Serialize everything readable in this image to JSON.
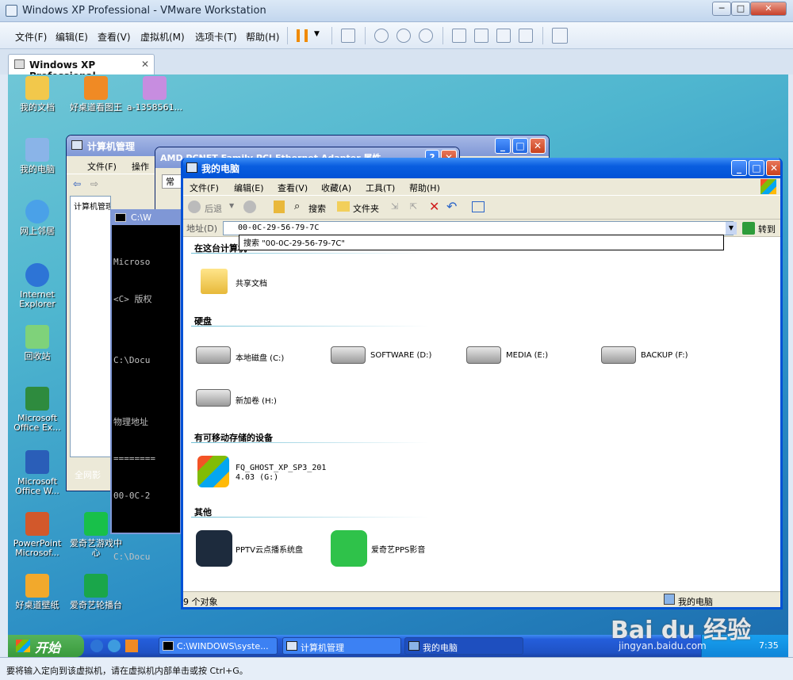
{
  "host": {
    "title": "Windows XP Professional - VMware Workstation",
    "menu": [
      "文件(F)",
      "编辑(E)",
      "查看(V)",
      "虚拟机(M)",
      "选项卡(T)",
      "帮助(H)"
    ],
    "tab": "Windows XP Professional",
    "status": "要将输入定向到该虚拟机，请在虚拟机内部单击或按 Ctrl+G。"
  },
  "desktop": {
    "icons": [
      {
        "label": "我的文档",
        "color": "#f2c84b"
      },
      {
        "label": "好桌道看图王",
        "color": "#f08a24"
      },
      {
        "label": "a-1358561...",
        "color": "#c78de0"
      },
      {
        "label": "我的电脑",
        "color": "#8ab4e8"
      },
      {
        "label": "网上邻居",
        "color": "#4aa1e8"
      },
      {
        "label": "Internet Explorer",
        "color": "#2d74d6"
      },
      {
        "label": "回收站",
        "color": "#7fd27a"
      },
      {
        "label": "Microsoft Office Ex...",
        "color": "#2e8b3e"
      },
      {
        "label": "Microsoft Office W...",
        "color": "#2a5eb8"
      },
      {
        "label": "PowerPoint Microsof...",
        "color": "#d2582b"
      },
      {
        "label": "爱奇艺游戏中心",
        "color": "#18c04a"
      },
      {
        "label": "好桌道壁纸",
        "color": "#f2a92c"
      },
      {
        "label": "爱奇艺轮播台",
        "color": "#1aa64a"
      },
      {
        "label": "全网影"
      }
    ]
  },
  "comp_mgmt": {
    "title": "计算机管理",
    "menu": [
      "文件(F)",
      "操作"
    ],
    "tree_root": "计算机管理(本地"
  },
  "nic_props": {
    "title": "AMD PCNET Family PCI Ethernet Adapter 属性",
    "tab": "常"
  },
  "cmd": {
    "title": "C:\\W",
    "lines": [
      "Microso",
      "<C> 版权",
      "",
      "C:\\Docu",
      "",
      "物理地址",
      "========",
      "00-0C-2",
      "",
      "C:\\Docu"
    ]
  },
  "my_computer": {
    "title": "我的电脑",
    "menu": [
      "文件(F)",
      "编辑(E)",
      "查看(V)",
      "收藏(A)",
      "工具(T)",
      "帮助(H)"
    ],
    "toolbar": {
      "back": "后退",
      "search": "搜索",
      "folders": "文件夹"
    },
    "address_label": "地址(D)",
    "address_value": "00-0C-29-56-79-7C",
    "address_suggestion": "搜索 \"00-0C-29-56-79-7C\"",
    "go_label": "转到",
    "sections": {
      "this_computer": "在这台计算机",
      "hard_disks": "硬盘",
      "removable": "有可移动存储的设备",
      "other": "其他"
    },
    "shared": "共享文档",
    "drives": [
      "本地磁盘 (C:)",
      "SOFTWARE (D:)",
      "MEDIA (E:)",
      "BACKUP (F:)",
      "新加卷 (H:)"
    ],
    "removable_line1": "FQ_GHOST_XP_SP3_201",
    "removable_line2": "4.03 (G:)",
    "others": [
      "PPTV云点播系统盘",
      "爱奇艺PPS影音"
    ],
    "status_count": "9 个对象",
    "status_location": "我的电脑"
  },
  "taskbar": {
    "start": "开始",
    "tasks": [
      "C:\\WINDOWS\\syste...",
      "计算机管理",
      "我的电脑"
    ],
    "clock": "7:35"
  },
  "watermark": {
    "brand": "Bai du 经验",
    "url": "jingyan.baidu.com"
  }
}
